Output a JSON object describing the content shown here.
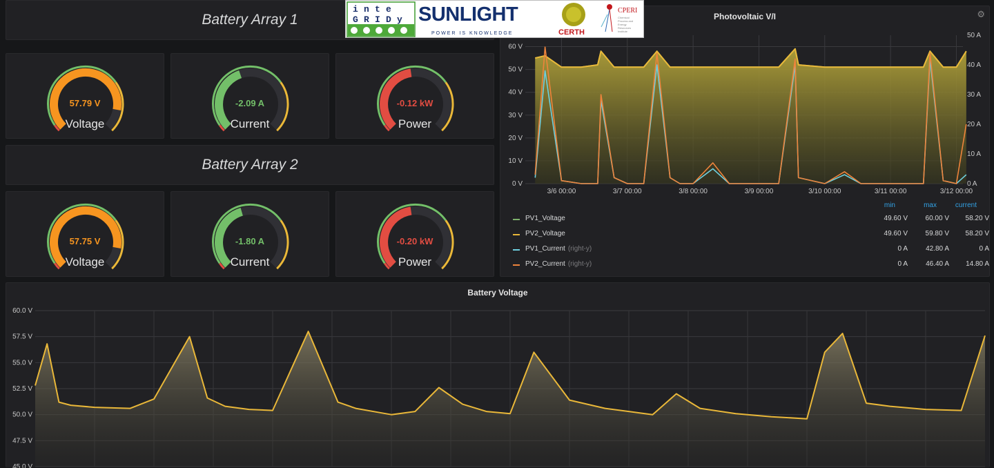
{
  "logos": {
    "integridy_letters": [
      "i",
      "n",
      "t",
      "e",
      "G",
      "R",
      "I",
      "D",
      "y"
    ],
    "sunlight": "SUNLIGHT",
    "sunlight_tagline": "POWER IS KNOWLEDGE",
    "certh": "CERTH",
    "cperi": "CPERI",
    "cperi_caption": [
      "Chemical",
      "Process and",
      "Energy",
      "Resources",
      "Institute"
    ]
  },
  "battery_arrays": [
    {
      "title": "Battery Array 1",
      "gauges": [
        {
          "label": "Voltage",
          "value": "57.79 V",
          "fill": 0.87,
          "color": "#f79520"
        },
        {
          "label": "Current",
          "value": "-2.09 A",
          "fill": 0.43,
          "color": "#73bf69"
        },
        {
          "label": "Power",
          "value": "-0.12 kW",
          "fill": 0.47,
          "color": "#e24d42"
        }
      ]
    },
    {
      "title": "Battery Array 2",
      "gauges": [
        {
          "label": "Voltage",
          "value": "57.75 V",
          "fill": 0.87,
          "color": "#f79520"
        },
        {
          "label": "Current",
          "value": "-1.80 A",
          "fill": 0.44,
          "color": "#73bf69"
        },
        {
          "label": "Power",
          "value": "-0.20 kW",
          "fill": 0.47,
          "color": "#e24d42"
        }
      ]
    }
  ],
  "pv_panel": {
    "title": "Photovoltaic V/I",
    "legend_headers": [
      "min",
      "max",
      "current"
    ],
    "legend": [
      {
        "name": "PV1_Voltage",
        "suffix": "",
        "color": "#7eb26d",
        "min": "49.60 V",
        "max": "60.00 V",
        "current": "58.20 V"
      },
      {
        "name": "PV2_Voltage",
        "suffix": "",
        "color": "#eab839",
        "min": "49.60 V",
        "max": "59.80 V",
        "current": "58.20 V"
      },
      {
        "name": "PV1_Current",
        "suffix": "(right-y)",
        "color": "#6ed0e0",
        "min": "0 A",
        "max": "42.80 A",
        "current": "0 A"
      },
      {
        "name": "PV2_Current",
        "suffix": "(right-y)",
        "color": "#ef843c",
        "min": "0 A",
        "max": "46.40 A",
        "current": "14.80 A"
      }
    ]
  },
  "battery_voltage_panel": {
    "title": "Battery Voltage"
  },
  "chart_data": [
    {
      "type": "line",
      "title": "Photovoltaic V/I",
      "x_ticks": [
        "3/6 00:00",
        "3/7 00:00",
        "3/8 00:00",
        "3/9 00:00",
        "3/10 00:00",
        "3/11 00:00",
        "3/12 00:00"
      ],
      "y_left_ticks": [
        "0 V",
        "10 V",
        "20 V",
        "30 V",
        "40 V",
        "50 V",
        "60 V"
      ],
      "y_right_ticks": [
        "0 A",
        "10 A",
        "20 A",
        "30 A",
        "40 A",
        "50 A"
      ],
      "ylim_left": [
        0,
        65
      ],
      "ylim_right": [
        0,
        50
      ],
      "grid": true,
      "x_days": [
        5.6,
        5.75,
        6.0,
        6.3,
        6.55,
        6.6,
        6.8,
        7.0,
        7.25,
        7.45,
        7.65,
        7.8,
        8.0,
        8.3,
        8.55,
        9.0,
        9.3,
        9.55,
        9.6,
        10.0,
        10.3,
        10.55,
        11.0,
        11.5,
        11.6,
        11.8,
        12.0,
        12.15
      ],
      "series": [
        {
          "name": "PV1_Voltage",
          "axis": "left",
          "values": [
            55,
            56,
            51,
            51,
            52,
            58,
            51,
            51,
            51,
            58,
            51,
            51,
            51,
            51,
            51,
            51,
            51,
            59,
            52,
            51,
            51,
            51,
            51,
            51,
            58,
            51,
            51,
            58
          ]
        },
        {
          "name": "PV2_Voltage",
          "axis": "left",
          "values": [
            55,
            56,
            51,
            51,
            52,
            58,
            51,
            51,
            51,
            58,
            51,
            51,
            51,
            51,
            51,
            51,
            51,
            59,
            52,
            51,
            51,
            51,
            51,
            51,
            58,
            51,
            51,
            58
          ]
        },
        {
          "name": "PV1_Current",
          "axis": "right",
          "values": [
            2,
            38,
            1,
            0,
            0,
            28,
            2,
            0,
            0,
            40,
            2,
            0,
            0,
            5,
            0,
            0,
            0,
            40,
            2,
            0,
            3,
            0,
            0,
            0,
            42,
            1,
            0,
            3
          ]
        },
        {
          "name": "PV2_Current",
          "axis": "right",
          "values": [
            3,
            46,
            1,
            0,
            0,
            30,
            2,
            0,
            0,
            44,
            2,
            0,
            0,
            7,
            0,
            0,
            0,
            42,
            2,
            0,
            4,
            0,
            0,
            0,
            44,
            1,
            0,
            20
          ]
        }
      ]
    },
    {
      "type": "area",
      "title": "Battery Voltage",
      "y_ticks": [
        "45.0 V",
        "47.5 V",
        "50.0 V",
        "52.5 V",
        "55.0 V",
        "57.5 V",
        "60.0 V"
      ],
      "ylim": [
        45,
        60
      ],
      "grid": true,
      "x_days": [
        5.0,
        5.1,
        5.2,
        5.3,
        5.5,
        5.8,
        6.0,
        6.3,
        6.45,
        6.6,
        6.8,
        7.0,
        7.3,
        7.55,
        7.7,
        7.9,
        8.0,
        8.2,
        8.4,
        8.6,
        8.8,
        9.0,
        9.2,
        9.5,
        9.8,
        10.0,
        10.2,
        10.4,
        10.6,
        10.9,
        11.2,
        11.5,
        11.65,
        11.8,
        12.0,
        12.2,
        12.5,
        12.8,
        13.0
      ],
      "series": [
        {
          "name": "",
          "color": "#eab839",
          "values": [
            52.8,
            56.8,
            51.2,
            50.9,
            50.7,
            50.6,
            51.5,
            57.5,
            51.6,
            50.8,
            50.5,
            50.4,
            58.0,
            51.2,
            50.6,
            50.2,
            50.0,
            50.3,
            52.6,
            51.0,
            50.3,
            50.1,
            56.0,
            51.4,
            50.6,
            50.3,
            50.0,
            52.0,
            50.6,
            50.1,
            49.8,
            49.6,
            56.0,
            57.8,
            51.1,
            50.8,
            50.5,
            50.4,
            57.6
          ]
        }
      ]
    }
  ]
}
